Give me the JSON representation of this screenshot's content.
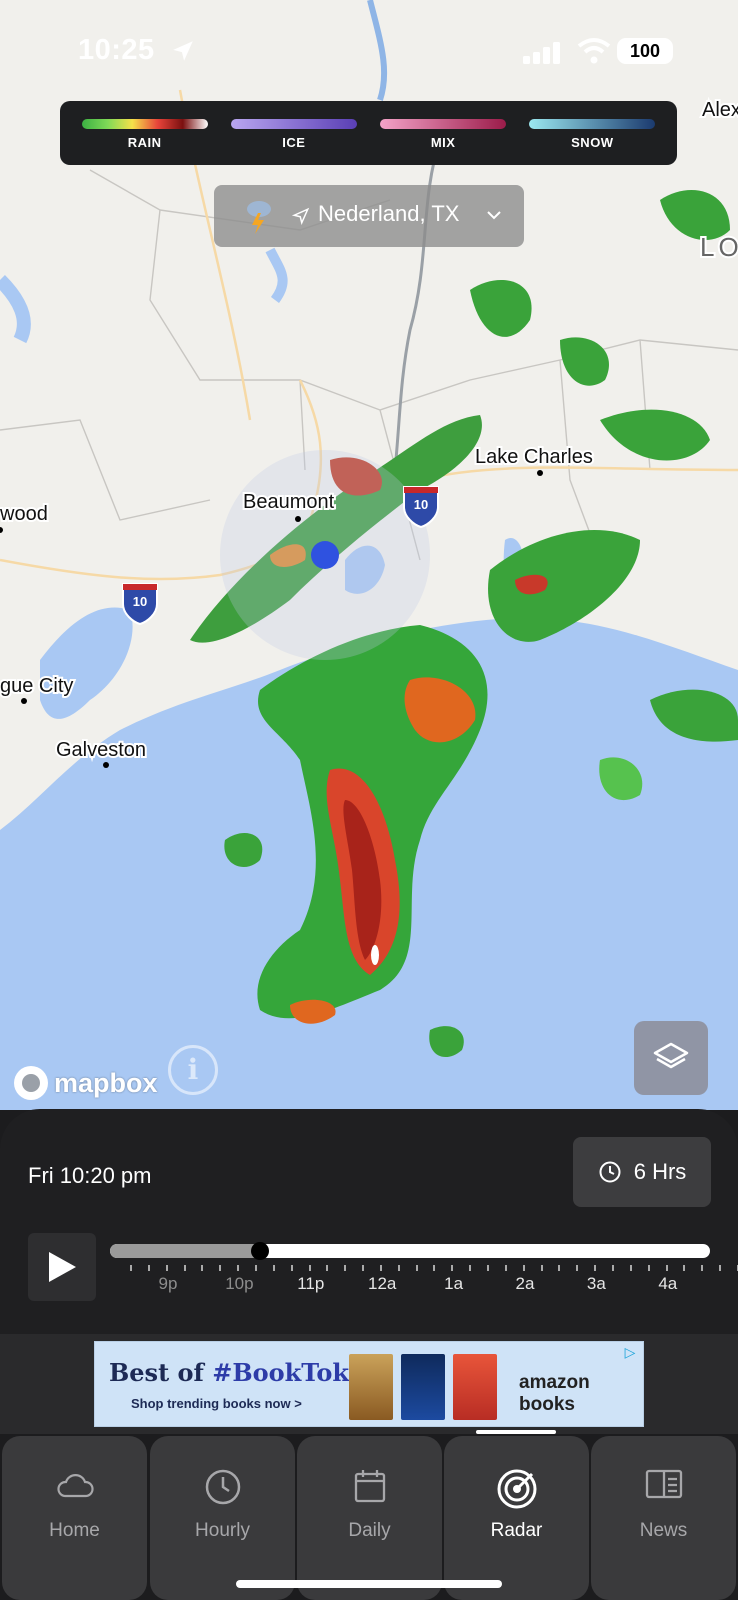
{
  "status_bar": {
    "time": "10:25",
    "battery": "100"
  },
  "legend": {
    "items": [
      {
        "label": "RAIN",
        "gradient": "linear-gradient(90deg,#3cb043,#7ed957,#f5e14a,#e8443a,#7a1010,#fff)"
      },
      {
        "label": "ICE",
        "gradient": "linear-gradient(90deg,#b9a6f0,#5a3fb5)"
      },
      {
        "label": "MIX",
        "gradient": "linear-gradient(90deg,#f4a3c8,#9b1c4a)"
      },
      {
        "label": "SNOW",
        "gradient": "linear-gradient(90deg,#9be8f0,#1b3a6e)"
      }
    ]
  },
  "location": {
    "name": "Nederland, TX"
  },
  "map": {
    "places": [
      {
        "name": "Beaumont"
      },
      {
        "name": "Lake Charles"
      },
      {
        "name": "Galveston"
      },
      {
        "name": "gue City"
      },
      {
        "name": "wood"
      },
      {
        "name": "Alex"
      },
      {
        "name": "LO"
      }
    ],
    "highway_shields": [
      "10",
      "10"
    ],
    "attribution": "mapbox"
  },
  "timeline": {
    "datetime": "Fri 10:20 pm",
    "range_label": "6 Hrs",
    "progress": 0.25,
    "labels": [
      "9p",
      "10p",
      "11p",
      "12a",
      "1a",
      "2a",
      "3a",
      "4a"
    ]
  },
  "ad": {
    "headline_prefix": "Best of ",
    "headline_tag": "#BookTok",
    "subline": "Shop trending books now >",
    "brand": "amazon books"
  },
  "tabs": [
    {
      "label": "Home",
      "icon": "cloud-icon"
    },
    {
      "label": "Hourly",
      "icon": "clock-icon"
    },
    {
      "label": "Daily",
      "icon": "calendar-icon"
    },
    {
      "label": "Radar",
      "icon": "radar-icon",
      "active": true
    },
    {
      "label": "News",
      "icon": "news-icon"
    }
  ],
  "colors": {
    "accent_blue": "#2f52e0",
    "panel": "#1f1f21",
    "tab_bg": "#3a3a3c"
  }
}
